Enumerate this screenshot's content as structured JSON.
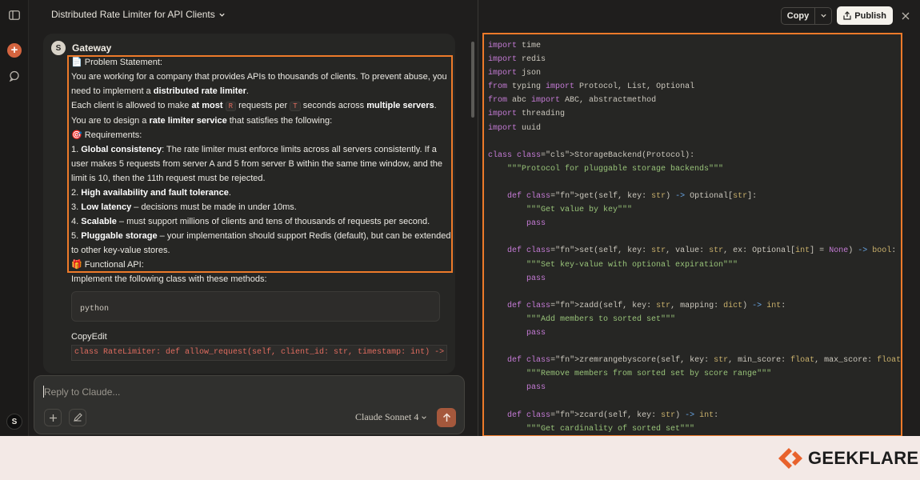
{
  "app": {
    "chat_title": "Distributed Rate Limiter for API Clients",
    "user_initial": "S"
  },
  "message": {
    "avatar_initial": "S",
    "author": "Gateway",
    "problem_heading": "Problem Statement:",
    "p1": "You are working for a company that provides APIs to thousands of clients. To prevent abuse, you need to implement a ",
    "p1_bold": "distributed rate limiter",
    "p1_end": ".",
    "p2_a": "Each client is allowed to make ",
    "p2_bold1": "at most",
    "p2_code_r": "R",
    "p2_b": " requests per ",
    "p2_code_t": "T",
    "p2_c": " seconds across ",
    "p2_bold2": "multiple servers",
    "p2_d": ". You are to design a ",
    "p2_bold3": "rate limiter service",
    "p2_e": " that satisfies the following:",
    "req_heading": "Requirements:",
    "req1_num": "1. ",
    "req1_bold": "Global consistency",
    "req1_text": ": The rate limiter must enforce limits across all servers consistently. If a user makes 5 requests from server A and 5 from server B within the same time window, and the limit is 10, then the 11th request must be rejected.",
    "req2_num": "2. ",
    "req2_bold": "High availability and fault tolerance",
    "req2_text": ".",
    "req3_num": "3. ",
    "req3_bold": "Low latency",
    "req3_text": " – decisions must be made in under 10ms.",
    "req4_num": "4. ",
    "req4_bold": "Scalable",
    "req4_text": " – must support millions of clients and tens of thousands of requests per second.",
    "req5_num": "5. ",
    "req5_bold": "Pluggable storage",
    "req5_text": " – your implementation should support Redis (default), but can be extended to other key-value stores.",
    "api_heading": "Functional API:",
    "api_text": "Implement the following class with these methods:",
    "code_lang": "python",
    "copyedit": "CopyEdit",
    "code_line": "class RateLimiter: def allow_request(self, client_id: str, timestamp: int) ->"
  },
  "reply": {
    "placeholder": "Reply to Claude...",
    "model": "Claude Sonnet 4"
  },
  "artifact": {
    "copy_label": "Copy",
    "publish_label": "Publish"
  },
  "code_lines": [
    "import time",
    "import redis",
    "import json",
    "from typing import Protocol, List, Optional",
    "from abc import ABC, abstractmethod",
    "import threading",
    "import uuid",
    "",
    "class StorageBackend(Protocol):",
    "    \"\"\"Protocol for pluggable storage backends\"\"\"",
    "",
    "    def get(self, key: str) -> Optional[str]:",
    "        \"\"\"Get value by key\"\"\"",
    "        pass",
    "",
    "    def set(self, key: str, value: str, ex: Optional[int] = None) -> bool:",
    "        \"\"\"Set key-value with optional expiration\"\"\"",
    "        pass",
    "",
    "    def zadd(self, key: str, mapping: dict) -> int:",
    "        \"\"\"Add members to sorted set\"\"\"",
    "        pass",
    "",
    "    def zremrangebyscore(self, key: str, min_score: float, max_score: float) -> int:",
    "        \"\"\"Remove members from sorted set by score range\"\"\"",
    "        pass",
    "",
    "    def zcard(self, key: str) -> int:",
    "        \"\"\"Get cardinality of sorted set\"\"\""
  ],
  "brand": {
    "name": "GEEKFLARE",
    "color": "#e8622c"
  }
}
